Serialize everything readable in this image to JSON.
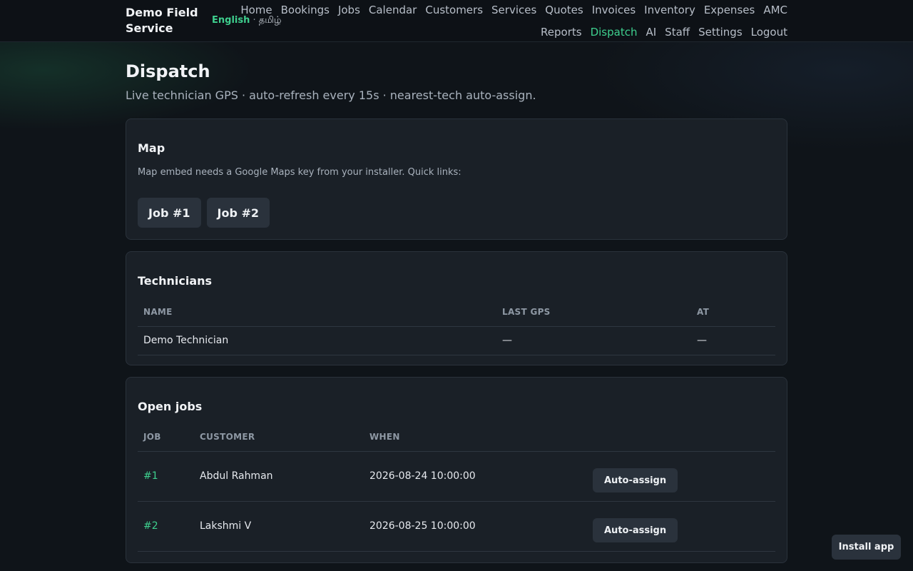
{
  "brand": "Demo Field Service",
  "lang": {
    "active": "English",
    "separator": "·",
    "other": "தமிழ்"
  },
  "nav": {
    "row1": [
      "Home",
      "Bookings",
      "Jobs",
      "Calendar",
      "Customers",
      "Services",
      "Quotes",
      "Invoices",
      "Inventory",
      "Expenses",
      "AMC"
    ],
    "row2": [
      "Reports",
      "Dispatch",
      "AI",
      "Staff",
      "Settings",
      "Logout"
    ],
    "active": "Dispatch",
    "accent_color": "#3ecf8e"
  },
  "page": {
    "title": "Dispatch",
    "subtitle": "Live technician GPS · auto-refresh every 15s · nearest-tech auto-assign."
  },
  "map": {
    "heading": "Map",
    "note": "Map embed needs a Google Maps key from your installer. Quick links:",
    "links": [
      "Job #1",
      "Job #2"
    ]
  },
  "technicians": {
    "heading": "Technicians",
    "columns": [
      "NAME",
      "LAST GPS",
      "AT"
    ],
    "rows": [
      {
        "name": "Demo Technician",
        "last_gps": "—",
        "at": "—"
      }
    ]
  },
  "open_jobs": {
    "heading": "Open jobs",
    "columns": [
      "JOB",
      "CUSTOMER",
      "WHEN",
      ""
    ],
    "rows": [
      {
        "job": "#1",
        "customer": "Abdul Rahman",
        "when": "2026-08-24 10:00:00",
        "action": "Auto-assign"
      },
      {
        "job": "#2",
        "customer": "Lakshmi V",
        "when": "2026-08-25 10:00:00",
        "action": "Auto-assign"
      }
    ]
  },
  "install_button": "Install app"
}
